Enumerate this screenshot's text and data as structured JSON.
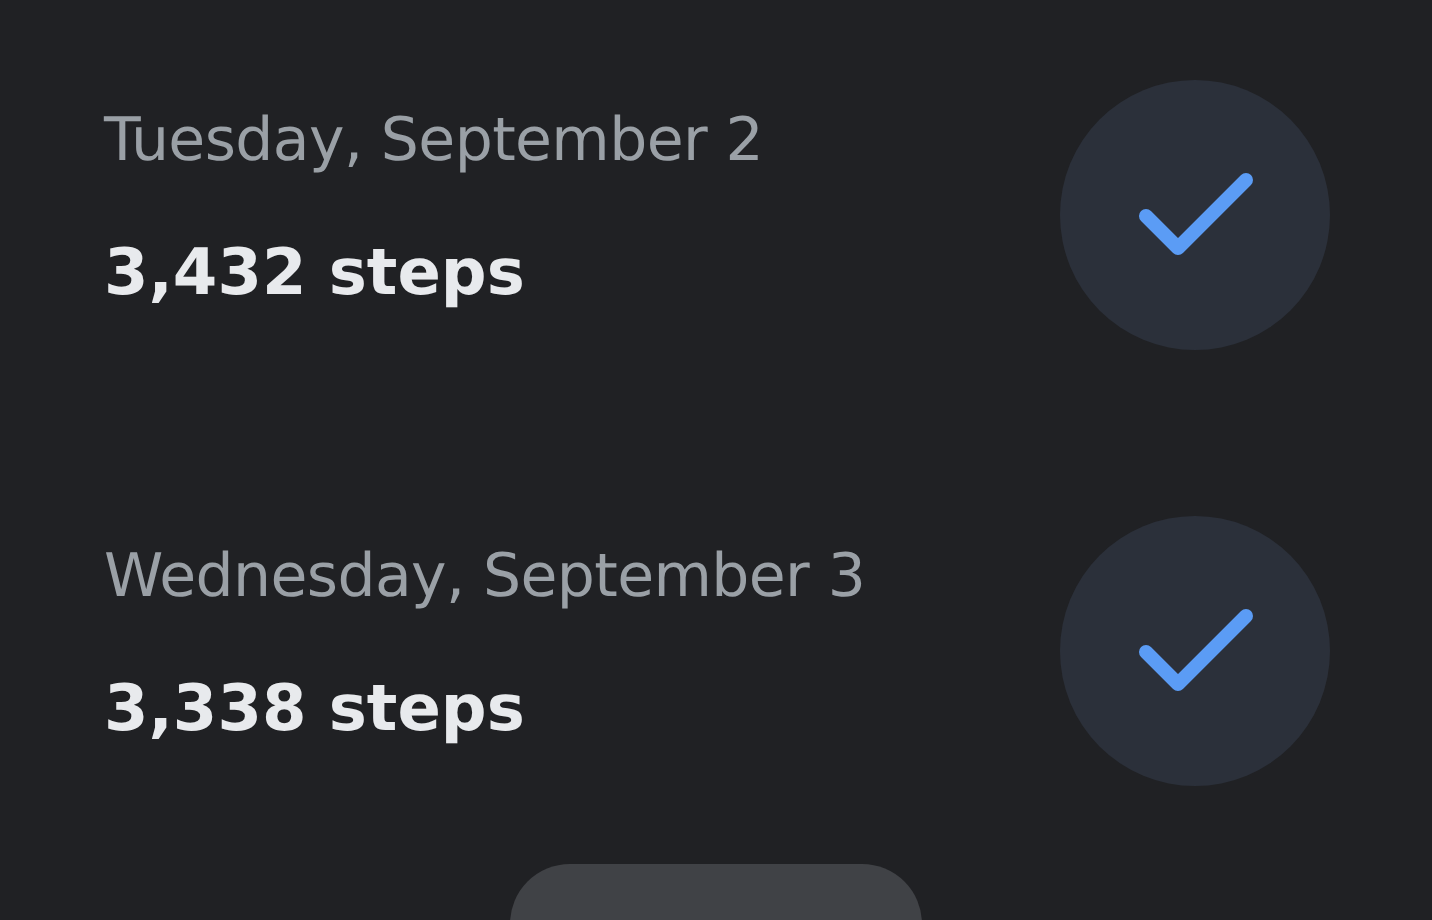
{
  "days": [
    {
      "date": "Tuesday, September 2",
      "steps": "3,432 steps",
      "checked": true
    },
    {
      "date": "Wednesday, September 3",
      "steps": "3,338 steps",
      "checked": true
    }
  ]
}
